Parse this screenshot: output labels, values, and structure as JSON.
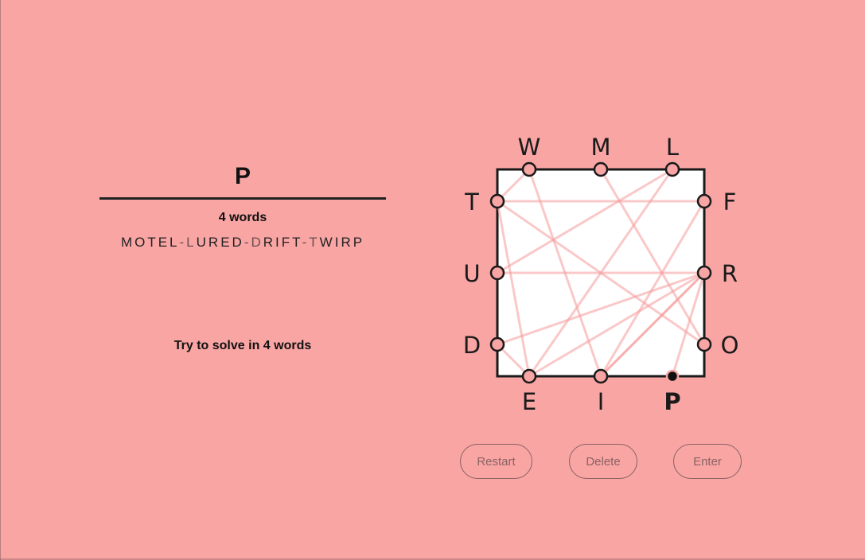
{
  "current_word": "P",
  "word_count_label": "4 words",
  "solution_parts": [
    {
      "text": "MOTEL",
      "style": "bright"
    },
    {
      "text": "-",
      "style": "dim"
    },
    {
      "text": "L",
      "style": "dim"
    },
    {
      "text": "URED",
      "style": "bright"
    },
    {
      "text": "-",
      "style": "dim"
    },
    {
      "text": "D",
      "style": "dim"
    },
    {
      "text": "RIFT",
      "style": "bright"
    },
    {
      "text": "-",
      "style": "dim"
    },
    {
      "text": "T",
      "style": "dim"
    },
    {
      "text": "WIRP",
      "style": "bright"
    }
  ],
  "goal_text": "Try to solve in 4 words",
  "board": {
    "sides": {
      "top": [
        "W",
        "M",
        "L"
      ],
      "right": [
        "F",
        "R",
        "O"
      ],
      "bottom": [
        "E",
        "I",
        "P"
      ],
      "left": [
        "T",
        "U",
        "D"
      ]
    },
    "active_letter": "P",
    "line_color": "#f59a9a",
    "path": [
      "M",
      "O",
      "T",
      "E",
      "L",
      "U",
      "R",
      "E",
      "D",
      "R",
      "I",
      "F",
      "T",
      "W",
      "I",
      "R",
      "P"
    ]
  },
  "buttons": {
    "restart": "Restart",
    "delete": "Delete",
    "enter": "Enter"
  },
  "colors": {
    "background": "#f8a5a4",
    "box_fill": "#ffffff",
    "box_stroke": "#1a1a1a",
    "node_fill": "#f8a5a4",
    "button_text": "#8b6262"
  }
}
